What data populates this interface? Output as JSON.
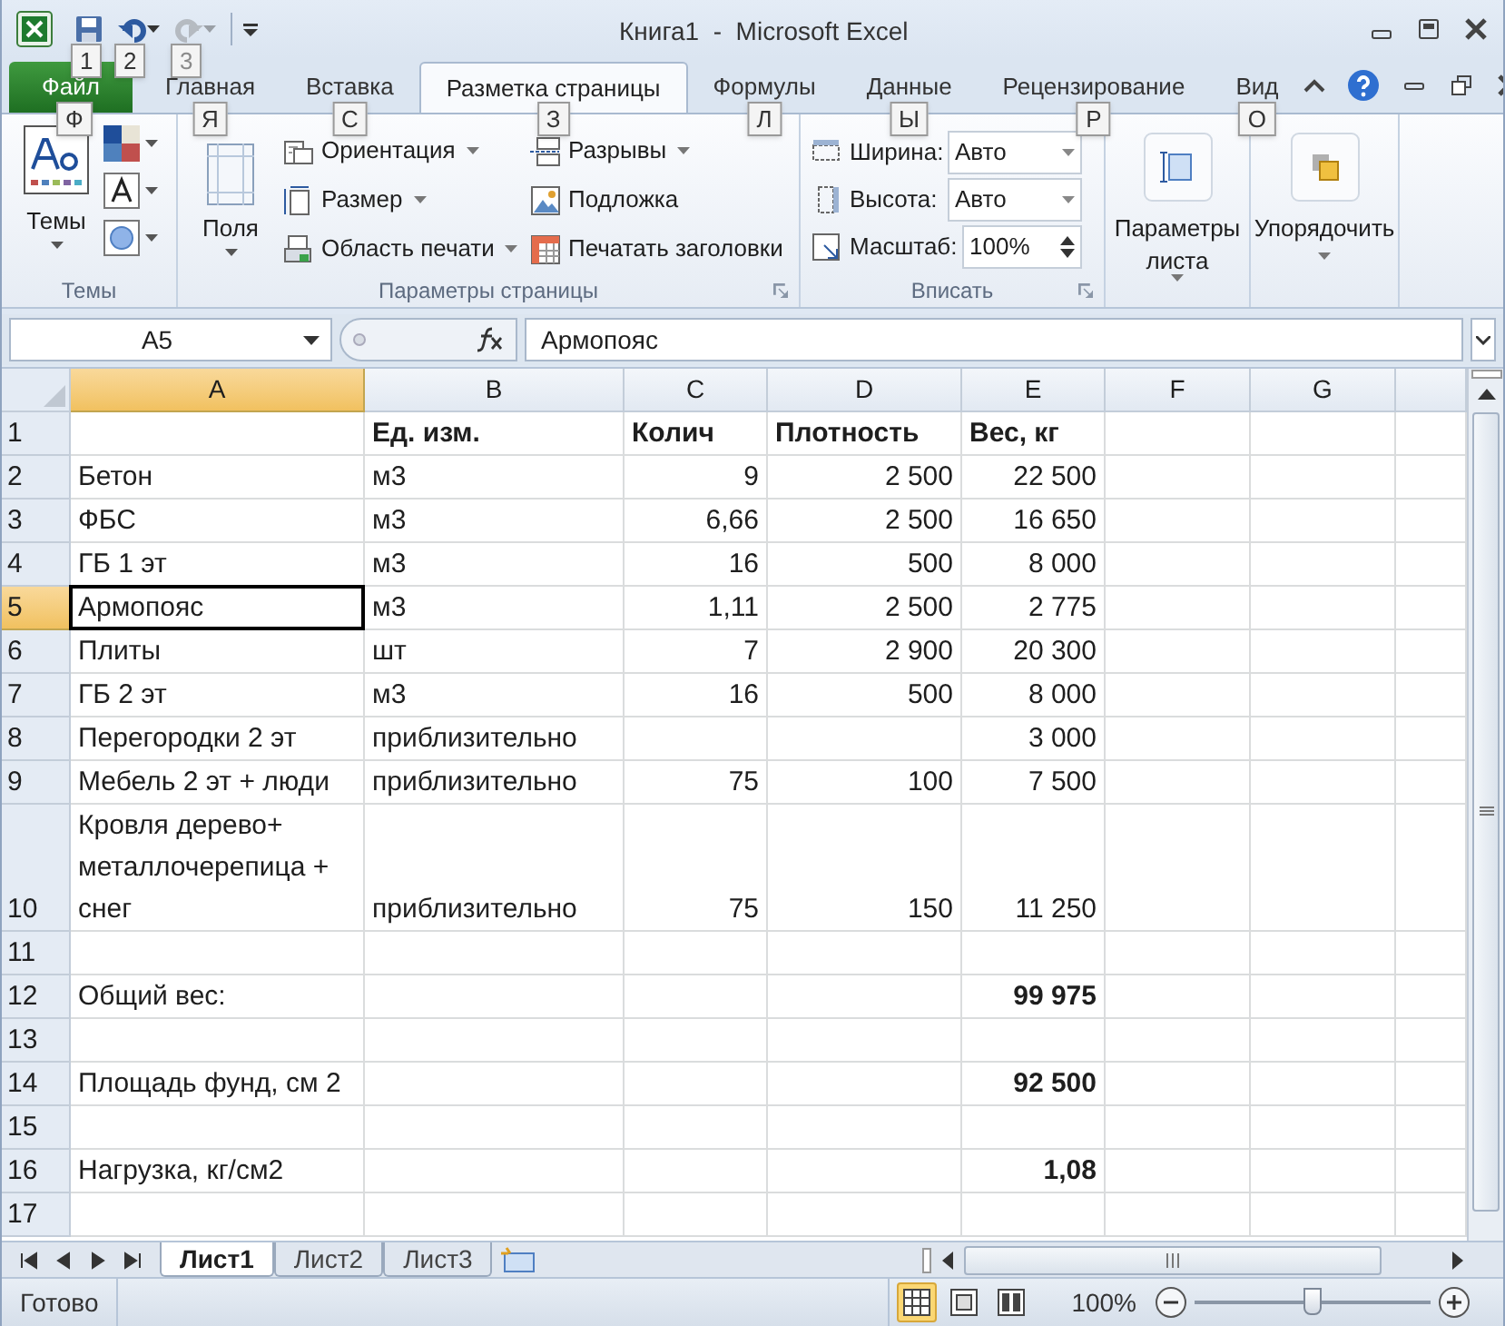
{
  "window": {
    "title": "Книга1  -  Microsoft Excel"
  },
  "quick_access": [
    {
      "kind": "save",
      "key_tip": "1",
      "disabled": false
    },
    {
      "kind": "undo",
      "key_tip": "2",
      "disabled": false
    },
    {
      "kind": "redo",
      "key_tip": "3",
      "disabled": true
    }
  ],
  "tabs": [
    {
      "label": "Файл",
      "kind": "file",
      "key_tip": "Ф",
      "selected": false
    },
    {
      "label": "Главная",
      "kind": "tab",
      "key_tip": "Я",
      "selected": false
    },
    {
      "label": "Вставка",
      "kind": "tab",
      "key_tip": "С",
      "selected": false
    },
    {
      "label": "Разметка страницы",
      "kind": "tab",
      "key_tip": "З",
      "selected": true
    },
    {
      "label": "Формулы",
      "kind": "tab",
      "key_tip": "Л",
      "selected": false
    },
    {
      "label": "Данные",
      "kind": "tab",
      "key_tip": "Ы",
      "selected": false
    },
    {
      "label": "Рецензирование",
      "kind": "tab",
      "key_tip": "Р",
      "selected": false
    },
    {
      "label": "Вид",
      "kind": "tab",
      "key_tip": "О",
      "selected": false
    }
  ],
  "ribbon": {
    "themes": {
      "title": "Темы",
      "button": "Темы"
    },
    "page_setup": {
      "title": "Параметры страницы",
      "big_button": "Поля",
      "items": [
        {
          "label": "Ориентация",
          "kind": "orientation",
          "dropdown": true
        },
        {
          "label": "Размер",
          "kind": "size",
          "dropdown": true
        },
        {
          "label": "Область печати",
          "kind": "print_area",
          "dropdown": true
        },
        {
          "label": "Разрывы",
          "kind": "breaks",
          "dropdown": true
        },
        {
          "label": "Подложка",
          "kind": "background",
          "dropdown": false
        },
        {
          "label": "Печатать заголовки",
          "kind": "titles",
          "dropdown": false
        }
      ]
    },
    "scale": {
      "title": "Вписать",
      "fields": [
        {
          "label": "Ширина:",
          "value": "Авто",
          "kind": "dropdown"
        },
        {
          "label": "Высота:",
          "value": "Авто",
          "kind": "dropdown"
        },
        {
          "label": "Масштаб:",
          "value": "100%",
          "kind": "spinner"
        }
      ]
    },
    "big_buttons": [
      {
        "lines": [
          "Параметры",
          "листа"
        ],
        "kind": "sheet_options"
      },
      {
        "lines": [
          "Упорядочить"
        ],
        "kind": "arrange"
      }
    ]
  },
  "formula_bar": {
    "name_box": "A5",
    "formula": "Армопояс"
  },
  "sheet": {
    "columns": [
      {
        "label": "A",
        "selected": true
      },
      {
        "label": "B",
        "selected": false
      },
      {
        "label": "C",
        "selected": false
      },
      {
        "label": "D",
        "selected": false
      },
      {
        "label": "E",
        "selected": false
      },
      {
        "label": "F",
        "selected": false
      },
      {
        "label": "G",
        "selected": false
      }
    ],
    "rows": [
      {
        "number": "1",
        "selected": false,
        "cells": {
          "B": {
            "text": "Ед. изм.",
            "kind": "text",
            "bold": true
          },
          "C": {
            "text": "Колич",
            "kind": "text",
            "bold": true
          },
          "D": {
            "text": "Плотность",
            "kind": "text",
            "bold": true
          },
          "E": {
            "text": "Вес, кг",
            "kind": "text",
            "bold": true
          }
        }
      },
      {
        "number": "2",
        "selected": false,
        "cells": {
          "A": {
            "text": "Бетон",
            "kind": "text",
            "bold": false
          },
          "B": {
            "text": "м3",
            "kind": "text",
            "bold": false
          },
          "C": {
            "text": "9",
            "kind": "number",
            "bold": false
          },
          "D": {
            "text": "2 500",
            "kind": "number",
            "bold": false
          },
          "E": {
            "text": "22 500",
            "kind": "number",
            "bold": false
          }
        }
      },
      {
        "number": "3",
        "selected": false,
        "cells": {
          "A": {
            "text": "ФБС",
            "kind": "text",
            "bold": false
          },
          "B": {
            "text": "м3",
            "kind": "text",
            "bold": false
          },
          "C": {
            "text": "6,66",
            "kind": "number",
            "bold": false
          },
          "D": {
            "text": "2 500",
            "kind": "number",
            "bold": false
          },
          "E": {
            "text": "16 650",
            "kind": "number",
            "bold": false
          }
        }
      },
      {
        "number": "4",
        "selected": false,
        "cells": {
          "A": {
            "text": "ГБ 1 эт",
            "kind": "text",
            "bold": false
          },
          "B": {
            "text": "м3",
            "kind": "text",
            "bold": false
          },
          "C": {
            "text": "16",
            "kind": "number",
            "bold": false
          },
          "D": {
            "text": "500",
            "kind": "number",
            "bold": false
          },
          "E": {
            "text": "8 000",
            "kind": "number",
            "bold": false
          }
        }
      },
      {
        "number": "5",
        "selected": true,
        "cells": {
          "A": {
            "text": "Армопояс",
            "kind": "text",
            "bold": false
          },
          "B": {
            "text": "м3",
            "kind": "text",
            "bold": false
          },
          "C": {
            "text": "1,11",
            "kind": "number",
            "bold": false
          },
          "D": {
            "text": "2 500",
            "kind": "number",
            "bold": false
          },
          "E": {
            "text": "2 775",
            "kind": "number",
            "bold": false
          }
        }
      },
      {
        "number": "6",
        "selected": false,
        "cells": {
          "A": {
            "text": "Плиты",
            "kind": "text",
            "bold": false
          },
          "B": {
            "text": "шт",
            "kind": "text",
            "bold": false
          },
          "C": {
            "text": "7",
            "kind": "number",
            "bold": false
          },
          "D": {
            "text": "2 900",
            "kind": "number",
            "bold": false
          },
          "E": {
            "text": "20 300",
            "kind": "number",
            "bold": false
          }
        }
      },
      {
        "number": "7",
        "selected": false,
        "cells": {
          "A": {
            "text": "ГБ 2 эт",
            "kind": "text",
            "bold": false
          },
          "B": {
            "text": "м3",
            "kind": "text",
            "bold": false
          },
          "C": {
            "text": "16",
            "kind": "number",
            "bold": false
          },
          "D": {
            "text": "500",
            "kind": "number",
            "bold": false
          },
          "E": {
            "text": "8 000",
            "kind": "number",
            "bold": false
          }
        }
      },
      {
        "number": "8",
        "selected": false,
        "cells": {
          "A": {
            "text": "Перегородки 2 эт",
            "kind": "text",
            "bold": false
          },
          "B": {
            "text": "приблизительно",
            "kind": "text",
            "bold": false
          },
          "E": {
            "text": "3 000",
            "kind": "number",
            "bold": false
          }
        }
      },
      {
        "number": "9",
        "selected": false,
        "cells": {
          "A": {
            "text": "Мебель 2 эт + люди",
            "kind": "text",
            "bold": false
          },
          "B": {
            "text": "приблизительно",
            "kind": "text",
            "bold": false
          },
          "C": {
            "text": "75",
            "kind": "number",
            "bold": false
          },
          "D": {
            "text": "100",
            "kind": "number",
            "bold": false
          },
          "E": {
            "text": "7 500",
            "kind": "number",
            "bold": false
          }
        }
      },
      {
        "number": "10",
        "selected": false,
        "cells": {
          "A": {
            "text": "Кровля дерево+ металлочерепица + снег",
            "kind": "text",
            "bold": false
          },
          "B": {
            "text": "приблизительно",
            "kind": "text",
            "bold": false
          },
          "C": {
            "text": "75",
            "kind": "number",
            "bold": false
          },
          "D": {
            "text": "150",
            "kind": "number",
            "bold": false
          },
          "E": {
            "text": "11 250",
            "kind": "number",
            "bold": false
          }
        }
      },
      {
        "number": "11",
        "selected": false
      },
      {
        "number": "12",
        "selected": false,
        "cells": {
          "A": {
            "text": "Общий вес:",
            "kind": "text",
            "bold": false
          },
          "E": {
            "text": "99 975",
            "kind": "number",
            "bold": true
          }
        }
      },
      {
        "number": "13",
        "selected": false
      },
      {
        "number": "14",
        "selected": false,
        "cells": {
          "A": {
            "text": "Площадь фунд, см 2",
            "kind": "text",
            "bold": false
          },
          "E": {
            "text": "92 500",
            "kind": "number",
            "bold": true
          }
        }
      },
      {
        "number": "15",
        "selected": false
      },
      {
        "number": "16",
        "selected": false,
        "cells": {
          "A": {
            "text": "Нагрузка, кг/см2",
            "kind": "text",
            "bold": false
          },
          "E": {
            "text": "1,08",
            "kind": "number",
            "bold": true
          }
        }
      },
      {
        "number": "17",
        "selected": false
      }
    ]
  },
  "sheet_tabs": [
    {
      "label": "Лист1",
      "selected": true
    },
    {
      "label": "Лист2",
      "selected": false
    },
    {
      "label": "Лист3",
      "selected": false
    }
  ],
  "status_bar": {
    "text": "Готово",
    "views": [
      {
        "kind": "normal",
        "selected": true
      },
      {
        "kind": "page_layout",
        "selected": false
      },
      {
        "kind": "page_break",
        "selected": false
      }
    ],
    "zoom": "100%",
    "zoom_level": {
      "level": 0.5
    }
  }
}
